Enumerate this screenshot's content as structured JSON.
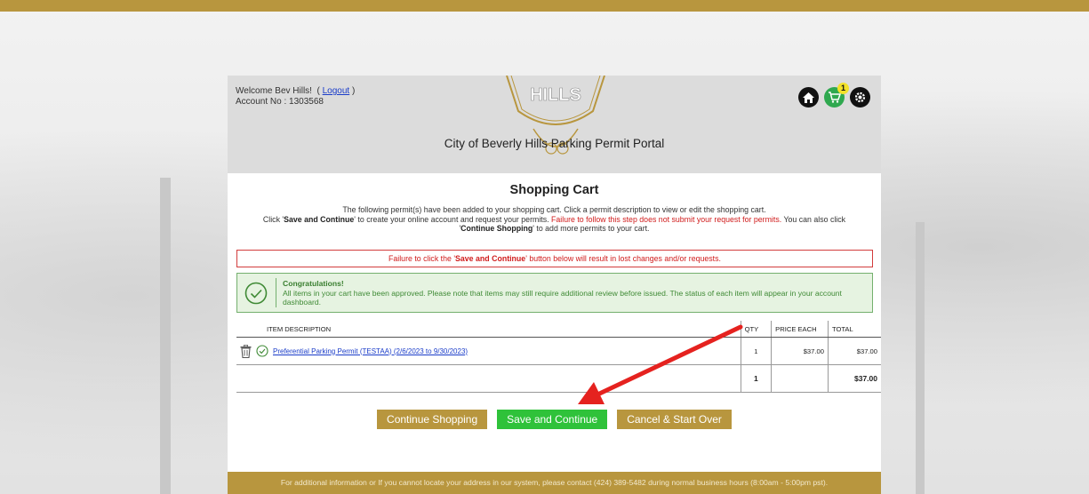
{
  "header": {
    "welcome_prefix": "Welcome Bev Hills!",
    "logout_label": "Logout",
    "account_label": "Account No : 1303568",
    "logo_text": "HILLS",
    "portal_title": "City of Beverly Hills Parking Permit Portal",
    "cart_count": "1",
    "icons": [
      "home-icon",
      "shopping-cart-icon",
      "settings-gear-icon"
    ]
  },
  "cart": {
    "title": "Shopping Cart",
    "intro_line1": "The following permit(s) have been added to your shopping cart. Click a permit description to view or edit the shopping cart.",
    "intro_line2_a": "Click '",
    "intro_line2_bold": "Save and Continue",
    "intro_line2_b": "' to create your online account and request your permits. ",
    "intro_line2_red": "Failure to follow this step does not submit your request for permits.",
    "intro_line2_c": " You can also click",
    "intro_line3_a": "'",
    "intro_line3_bold": "Continue Shopping",
    "intro_line3_b": "' to add more permits to your cart.",
    "warning_a": "Failure to click the '",
    "warning_bold": "Save and Continue",
    "warning_b": "' button below will result in lost changes and/or requests.",
    "success_title": "Congratulations!",
    "success_text": "All items in your cart have been approved. Please note that items may still require additional review before issued. The status of each item will appear in your account dashboard."
  },
  "table": {
    "headers": {
      "desc": "ITEM DESCRIPTION",
      "qty": "QTY",
      "price": "PRICE EACH",
      "total": "TOTAL"
    },
    "rows": [
      {
        "desc": "Preferential Parking Permit (TESTAA) (2/6/2023 to 9/30/2023)",
        "qty": "1",
        "price": "$37.00",
        "total": "$37.00"
      }
    ],
    "summary": {
      "qty": "1",
      "total": "$37.00"
    }
  },
  "buttons": {
    "continue_shopping": "Continue Shopping",
    "save_continue": "Save and Continue",
    "cancel_start_over": "Cancel & Start Over"
  },
  "footer": {
    "text": "For additional information or If you cannot locate your address in our system, please contact (424) 389-5482 during normal business hours (8:00am - 5:00pm pst)."
  },
  "colors": {
    "gold": "#b8963e",
    "green_button": "#2fc23a",
    "alert_red": "#d01c1c",
    "success_green": "#3f8a35",
    "link_blue": "#1a3cc9"
  }
}
